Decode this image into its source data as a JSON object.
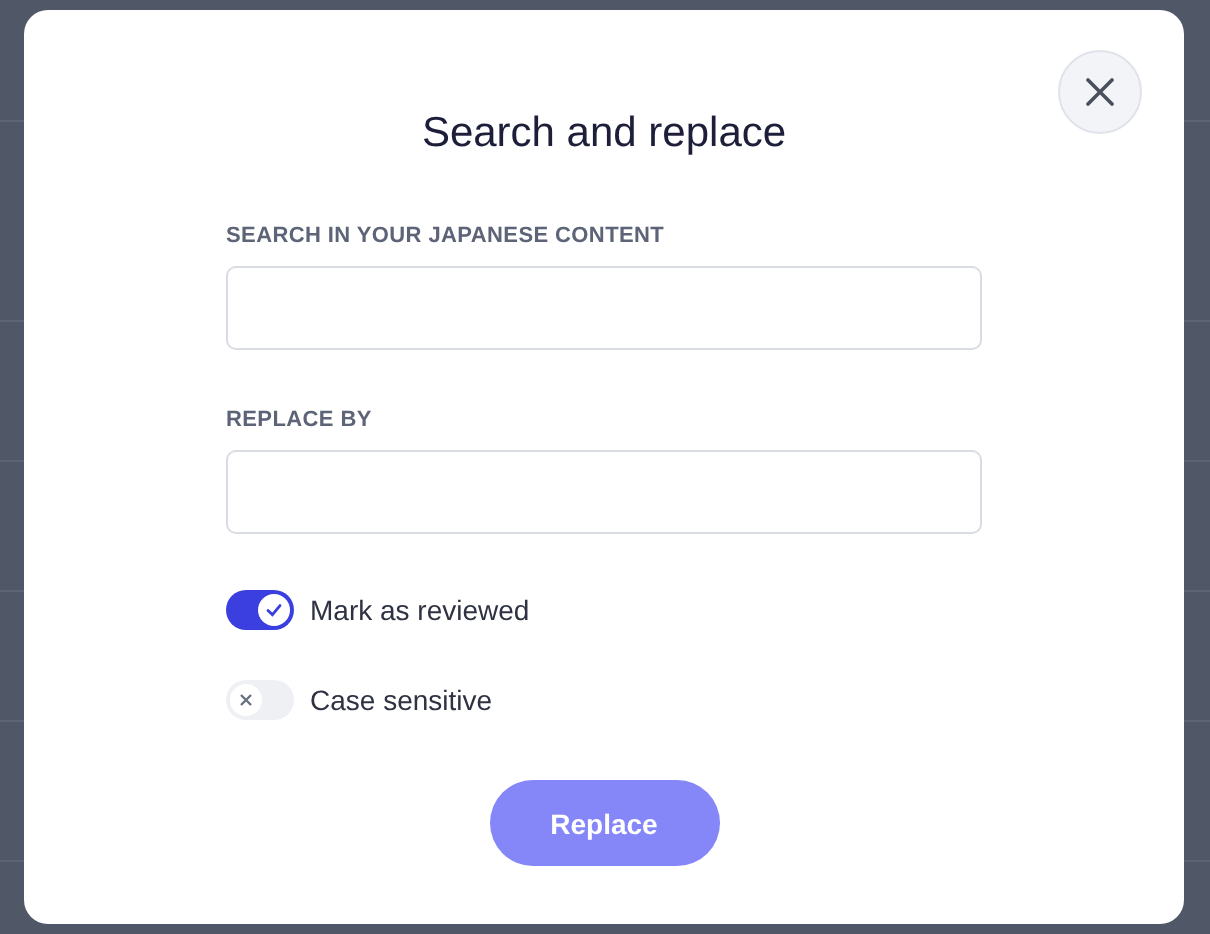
{
  "dialog": {
    "title": "Search and replace",
    "fields": [
      {
        "label": "SEARCH IN YOUR JAPANESE CONTENT"
      },
      {
        "label": "REPLACE BY"
      }
    ],
    "toggles": [
      {
        "label": "Mark as reviewed",
        "on": true
      },
      {
        "label": "Case sensitive",
        "on": false
      }
    ],
    "button": "Replace"
  }
}
